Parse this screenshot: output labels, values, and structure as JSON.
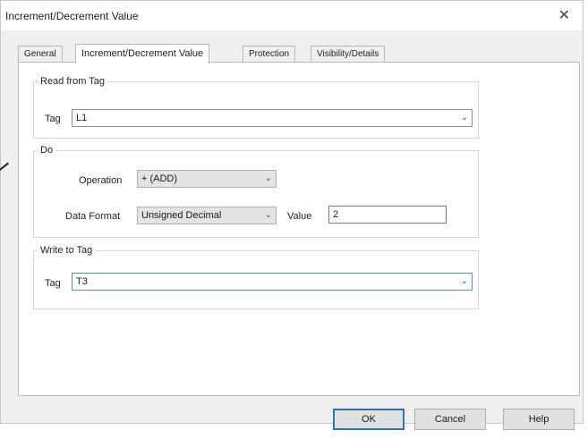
{
  "window": {
    "title": "Increment/Decrement Value",
    "close_icon": "close-icon"
  },
  "tabs": [
    {
      "label": "General",
      "active": false
    },
    {
      "label": "Increment/Decrement Value",
      "active": true
    },
    {
      "label": "Protection",
      "active": false
    },
    {
      "label": "Visibility/Details",
      "active": false
    }
  ],
  "read_from_tag": {
    "legend": "Read from Tag",
    "tag_label": "Tag",
    "tag_value": "L1"
  },
  "do": {
    "legend": "Do",
    "operation_label": "Operation",
    "operation_value": "+ (ADD)",
    "data_format_label": "Data Format",
    "data_format_value": "Unsigned Decimal",
    "value_label": "Value",
    "value_value": "2"
  },
  "write_to_tag": {
    "legend": "Write to Tag",
    "tag_label": "Tag",
    "tag_value": "T3"
  },
  "buttons": {
    "ok": "OK",
    "cancel": "Cancel",
    "help": "Help"
  },
  "colors": {
    "accent": "#2b72c3",
    "focus_border": "#4d8fd6"
  }
}
